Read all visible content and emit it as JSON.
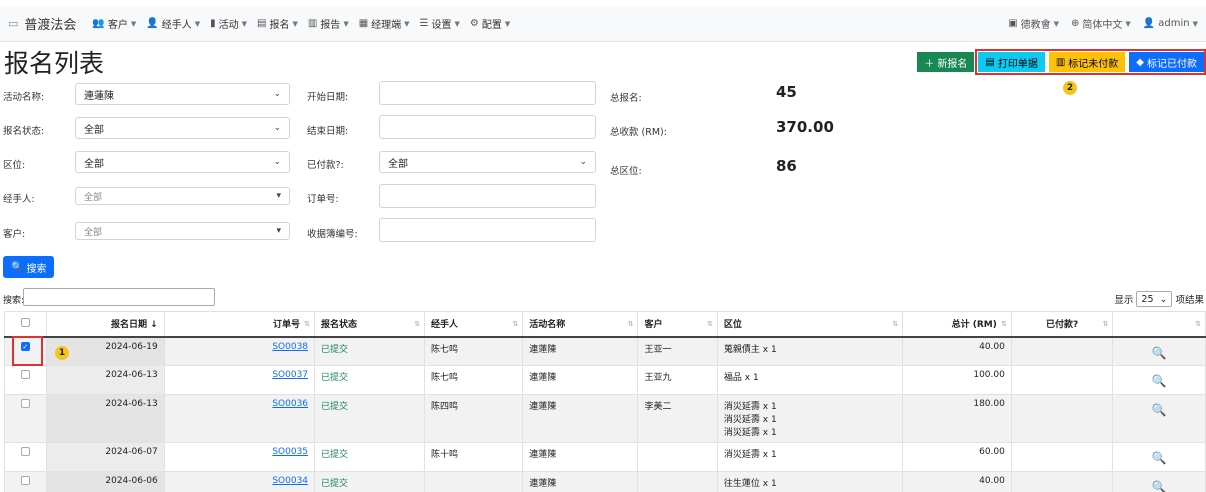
{
  "nav": {
    "brand": "普渡法会",
    "menu": [
      {
        "icon": "users-icon",
        "glyph": "👥",
        "label": "客户"
      },
      {
        "icon": "user-icon",
        "glyph": "👤",
        "label": "经手人"
      },
      {
        "icon": "chart-icon",
        "glyph": "▮",
        "label": "活动"
      },
      {
        "icon": "list-icon",
        "glyph": "▤",
        "label": "报名"
      },
      {
        "icon": "report-icon",
        "glyph": "▥",
        "label": "报告"
      },
      {
        "icon": "bank-icon",
        "glyph": "▦",
        "label": "经理端"
      },
      {
        "icon": "sliders-icon",
        "glyph": "☰",
        "label": "设置"
      },
      {
        "icon": "gear-icon",
        "glyph": "⚙",
        "label": "配置"
      }
    ],
    "right": {
      "temple": "德教會",
      "language": "简体中文",
      "user": "admin"
    }
  },
  "page": {
    "title": "报名列表"
  },
  "actions": {
    "new": "新报名",
    "print": "打印单据",
    "unpaid": "标记未付款",
    "paid": "标记已付款"
  },
  "markers": {
    "one": "1",
    "two": "2"
  },
  "filters": {
    "activity_label": "活动名称:",
    "activity_value": "連蓮陳",
    "status_label": "报名状态:",
    "status_value": "全部",
    "zone_label": "区位:",
    "zone_value": "全部",
    "handler_label": "经手人:",
    "handler_value": "全部",
    "customer_label": "客户:",
    "customer_value": "全部",
    "start_label": "开始日期:",
    "end_label": "结束日期:",
    "paid_label": "已付款?:",
    "paid_value": "全部",
    "order_label": "订单号:",
    "receipt_label": "收据簿编号:"
  },
  "stats": {
    "total_label": "总报名:",
    "total_value": "45",
    "revenue_label": "总收款 (RM):",
    "revenue_value": "370.00",
    "zones_label": "总区位:",
    "zones_value": "86"
  },
  "search": {
    "button": "搜索",
    "table_label": "搜索:",
    "show_prefix": "显示",
    "page_size": "25",
    "show_suffix": "项结果"
  },
  "table": {
    "headers": [
      "报名日期",
      "订单号",
      "报名状态",
      "经手人",
      "活动名称",
      "客户",
      "区位",
      "总计 (RM)",
      "已付款?"
    ],
    "rows": [
      {
        "date": "2024-06-19",
        "order": "SO0038",
        "status": "已提交",
        "handler": "陈七鸣",
        "activity": "連蓮陳",
        "customer": "王亚一",
        "zone": [
          "蒐親債主 x 1"
        ],
        "total": "40.00",
        "checked": true
      },
      {
        "date": "2024-06-13",
        "order": "SO0037",
        "status": "已提交",
        "handler": "陈七鸣",
        "activity": "連蓮陳",
        "customer": "王亚九",
        "zone": [
          "福品 x 1"
        ],
        "total": "100.00",
        "checked": false
      },
      {
        "date": "2024-06-13",
        "order": "SO0036",
        "status": "已提交",
        "handler": "陈四鸣",
        "activity": "連蓮陳",
        "customer": "李美二",
        "zone": [
          "消災延壽 x 1",
          "消災延壽 x 1",
          "消災延壽 x 1"
        ],
        "total": "180.00",
        "checked": false
      },
      {
        "date": "2024-06-07",
        "order": "SO0035",
        "status": "已提交",
        "handler": "陈十鸣",
        "activity": "連蓮陳",
        "customer": "",
        "zone": [
          "消災延壽 x 1"
        ],
        "total": "60.00",
        "checked": false
      },
      {
        "date": "2024-06-06",
        "order": "SO0034",
        "status": "已提交",
        "handler": "",
        "activity": "連蓮陳",
        "customer": "",
        "zone": [
          "往生蓮位 x 1"
        ],
        "total": "40.00",
        "checked": false
      }
    ]
  }
}
